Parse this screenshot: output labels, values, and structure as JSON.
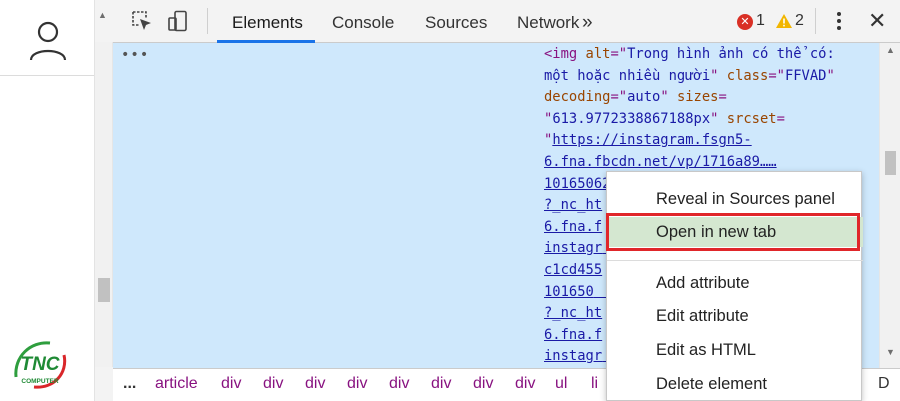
{
  "toolbar": {
    "tabs": [
      {
        "label": "Elements"
      },
      {
        "label": "Console"
      },
      {
        "label": "Sources"
      },
      {
        "label": "Network"
      }
    ],
    "more_tabs": "»",
    "error_count": "1",
    "warning_count": "2",
    "close": "✕",
    "active_tab_color": "#1a73e8"
  },
  "dom": {
    "ellipsis": "•••",
    "lines": [
      {
        "parts": [
          [
            "t-tag",
            "<img "
          ],
          [
            "t-attr",
            "alt"
          ],
          [
            "t-tag",
            "=\""
          ],
          [
            "t-val",
            "Trong hình ảnh có thể có:"
          ]
        ]
      },
      {
        "parts": [
          [
            "t-val",
            "một hoặc nhiều người"
          ],
          [
            "t-tag",
            "\" "
          ],
          [
            "t-attr",
            "class"
          ],
          [
            "t-tag",
            "=\""
          ],
          [
            "t-val",
            "FFVAD"
          ],
          [
            "t-tag",
            "\""
          ]
        ]
      },
      {
        "parts": [
          [
            "t-attr",
            "decoding"
          ],
          [
            "t-tag",
            "=\""
          ],
          [
            "t-val",
            "auto"
          ],
          [
            "t-tag",
            "\" "
          ],
          [
            "t-attr",
            "sizes"
          ],
          [
            "t-tag",
            "="
          ]
        ]
      },
      {
        "parts": [
          [
            "t-tag",
            "\""
          ],
          [
            "t-val",
            "613.9772338867188px"
          ],
          [
            "t-tag",
            "\" "
          ],
          [
            "t-attr",
            "srcset"
          ],
          [
            "t-tag",
            "="
          ]
        ]
      },
      {
        "parts": [
          [
            "t-tag",
            "\""
          ],
          [
            "t-link",
            "https://instagram.fsgn5-"
          ]
        ]
      },
      {
        "parts": [
          [
            "t-link",
            "6.fna.fbcdn.net/vp/1716a89……"
          ]
        ]
      },
      {
        "parts": [
          [
            "t-link",
            "101650"
          ],
          [
            "t-frag",
            "622 4736002066470024704……g"
          ]
        ]
      },
      {
        "parts": [
          [
            "t-link",
            "?_nc_ht"
          ]
        ]
      },
      {
        "parts": [
          [
            "t-link",
            "6.fna.f"
          ]
        ]
      },
      {
        "parts": [
          [
            "t-link",
            "instagr"
          ],
          [
            "t-frag",
            "                         /"
          ]
        ]
      },
      {
        "parts": [
          [
            "t-link",
            "c1cd455"
          ]
        ]
      },
      {
        "parts": [
          [
            "t-link",
            "101650"
          ],
          [
            "t-frag",
            "                        g"
          ]
        ]
      },
      {
        "parts": [
          [
            "t-link",
            "?_nc_ht"
          ]
        ]
      },
      {
        "parts": [
          [
            "t-link",
            "6.fna.f"
          ]
        ]
      },
      {
        "parts": [
          [
            "t-link",
            "instagr"
          ],
          [
            "t-frag",
            "                         /"
          ]
        ]
      }
    ]
  },
  "breadcrumb": {
    "items": [
      "...",
      "article",
      "div",
      "div",
      "div",
      "div",
      "div",
      "div",
      "div",
      "div",
      "ul",
      "li"
    ],
    "tail": "D"
  },
  "context_menu": {
    "items": [
      {
        "label": "Reveal in Sources panel"
      },
      {
        "label": "Open in new tab"
      },
      {
        "label": "Add attribute"
      },
      {
        "label": "Edit attribute"
      },
      {
        "label": "Edit as HTML"
      },
      {
        "label": "Delete element"
      }
    ],
    "highlight_color": "#d4e7d0",
    "callout_border_color": "#e0262a"
  },
  "logo": {
    "text": "TNC",
    "subtext": "COMPUTER"
  },
  "dom_background": "#cfe8fc"
}
